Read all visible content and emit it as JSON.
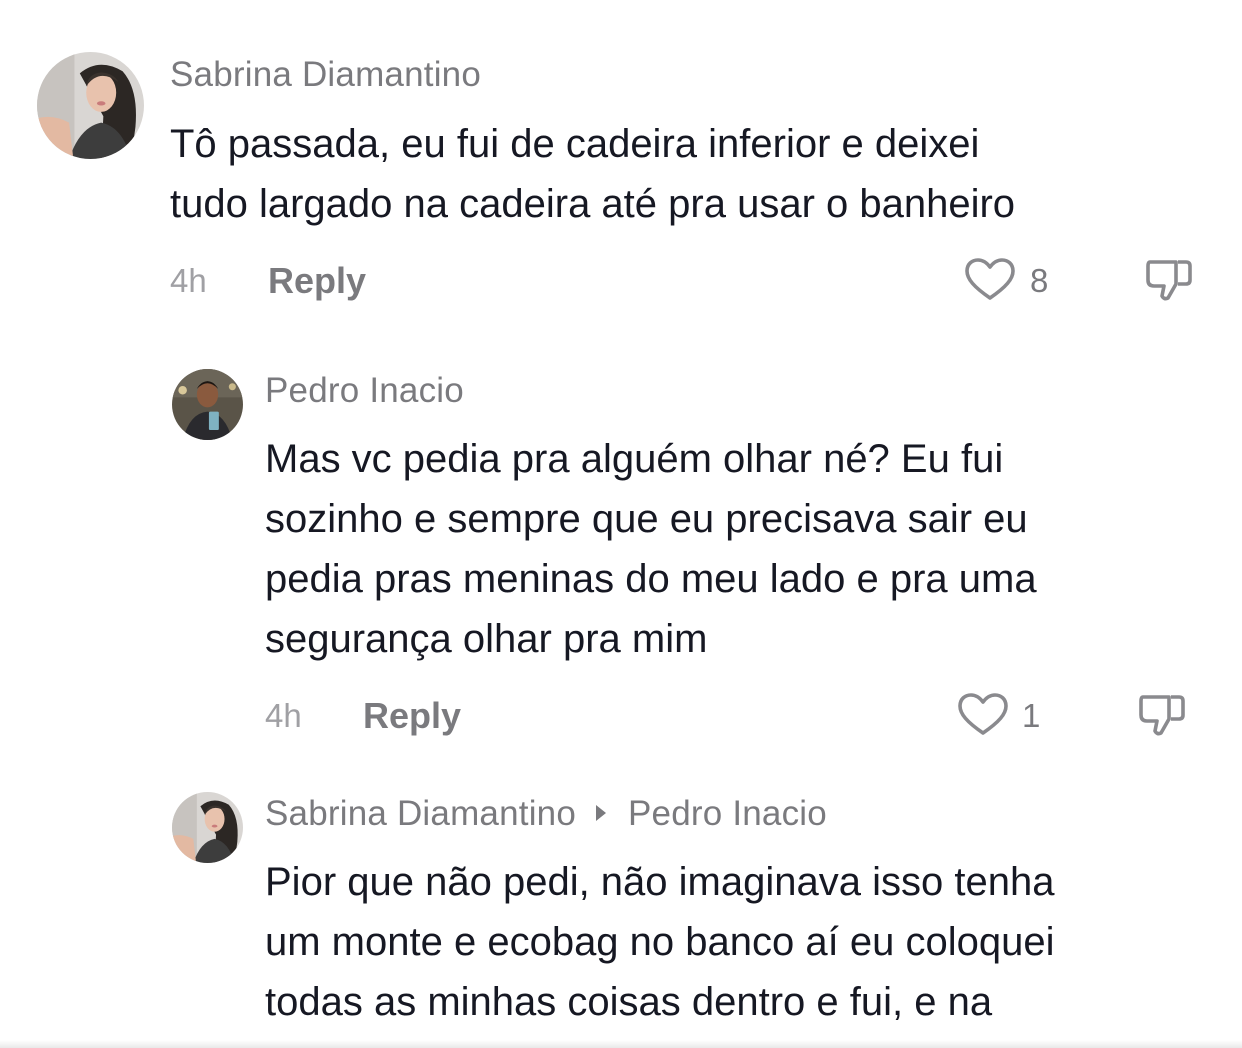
{
  "comments": [
    {
      "author": "Sabrina Diamantino",
      "lines": [
        "Tô passada, eu fui de cadeira inferior e deixei",
        "tudo largado na cadeira até pra usar o banheiro"
      ],
      "time": "4h",
      "reply_label": "Reply",
      "likes": "8",
      "avatar_icon": "avatar-woman"
    },
    {
      "author": "Pedro Inacio",
      "lines": [
        "Mas vc pedia pra alguém olhar né? Eu fui",
        "sozinho e sempre que eu precisava sair eu",
        "pedia pras meninas do meu lado e pra uma",
        "segurança olhar pra mim"
      ],
      "time": "4h",
      "reply_label": "Reply",
      "likes": "1",
      "avatar_icon": "avatar-man"
    },
    {
      "author": "Sabrina Diamantino",
      "reply_to": "Pedro Inacio",
      "lines": [
        "Pior que não pedi, não imaginava isso tenha",
        "um monte e ecobag no banco aí eu coloquei",
        "todas as minhas coisas dentro e fui, e na"
      ],
      "avatar_icon": "avatar-woman"
    }
  ],
  "colors": {
    "text": "#161823",
    "secondary": "#7a7a7e",
    "muted": "#a0a0a4",
    "background": "#ffffff"
  }
}
